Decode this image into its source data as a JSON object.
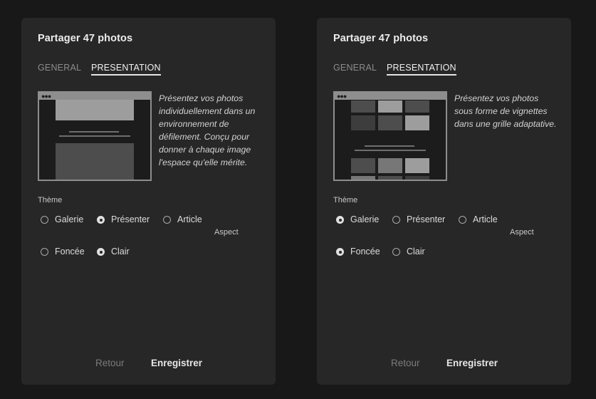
{
  "panels": [
    {
      "title": "Partager 47 photos",
      "tabs": [
        {
          "label": "GENERAL",
          "active": false
        },
        {
          "label": "PRESENTATION",
          "active": true
        }
      ],
      "preview_icon": "present-layout-preview-icon",
      "description": "Présentez vos photos individuellement dans un environnement de défilement. Conçu pour donner à chaque image l'espace qu'elle mérite.",
      "theme_label": "Thème",
      "aspect_label": "Aspect",
      "layout_options": [
        {
          "label": "Galerie",
          "checked": false
        },
        {
          "label": "Présenter",
          "checked": true
        },
        {
          "label": "Article",
          "checked": false
        }
      ],
      "appearance_options": [
        {
          "label": "Foncée",
          "checked": false
        },
        {
          "label": "Clair",
          "checked": true
        }
      ],
      "back_label": "Retour",
      "save_label": "Enregistrer"
    },
    {
      "title": "Partager 47 photos",
      "tabs": [
        {
          "label": "GENERAL",
          "active": false
        },
        {
          "label": "PRESENTATION",
          "active": true
        }
      ],
      "preview_icon": "gallery-grid-preview-icon",
      "description": "Présentez vos photos sous forme de vignettes dans une grille adaptative.",
      "theme_label": "Thème",
      "aspect_label": "Aspect",
      "layout_options": [
        {
          "label": "Galerie",
          "checked": true
        },
        {
          "label": "Présenter",
          "checked": false
        },
        {
          "label": "Article",
          "checked": false
        }
      ],
      "appearance_options": [
        {
          "label": "Foncée",
          "checked": true
        },
        {
          "label": "Clair",
          "checked": false
        }
      ],
      "back_label": "Retour",
      "save_label": "Enregistrer"
    }
  ],
  "colors": {
    "page_background": "#181818",
    "panel_background": "#272727",
    "active_tab": "#f2f2f2",
    "inactive_tab": "#8c8c8c"
  }
}
